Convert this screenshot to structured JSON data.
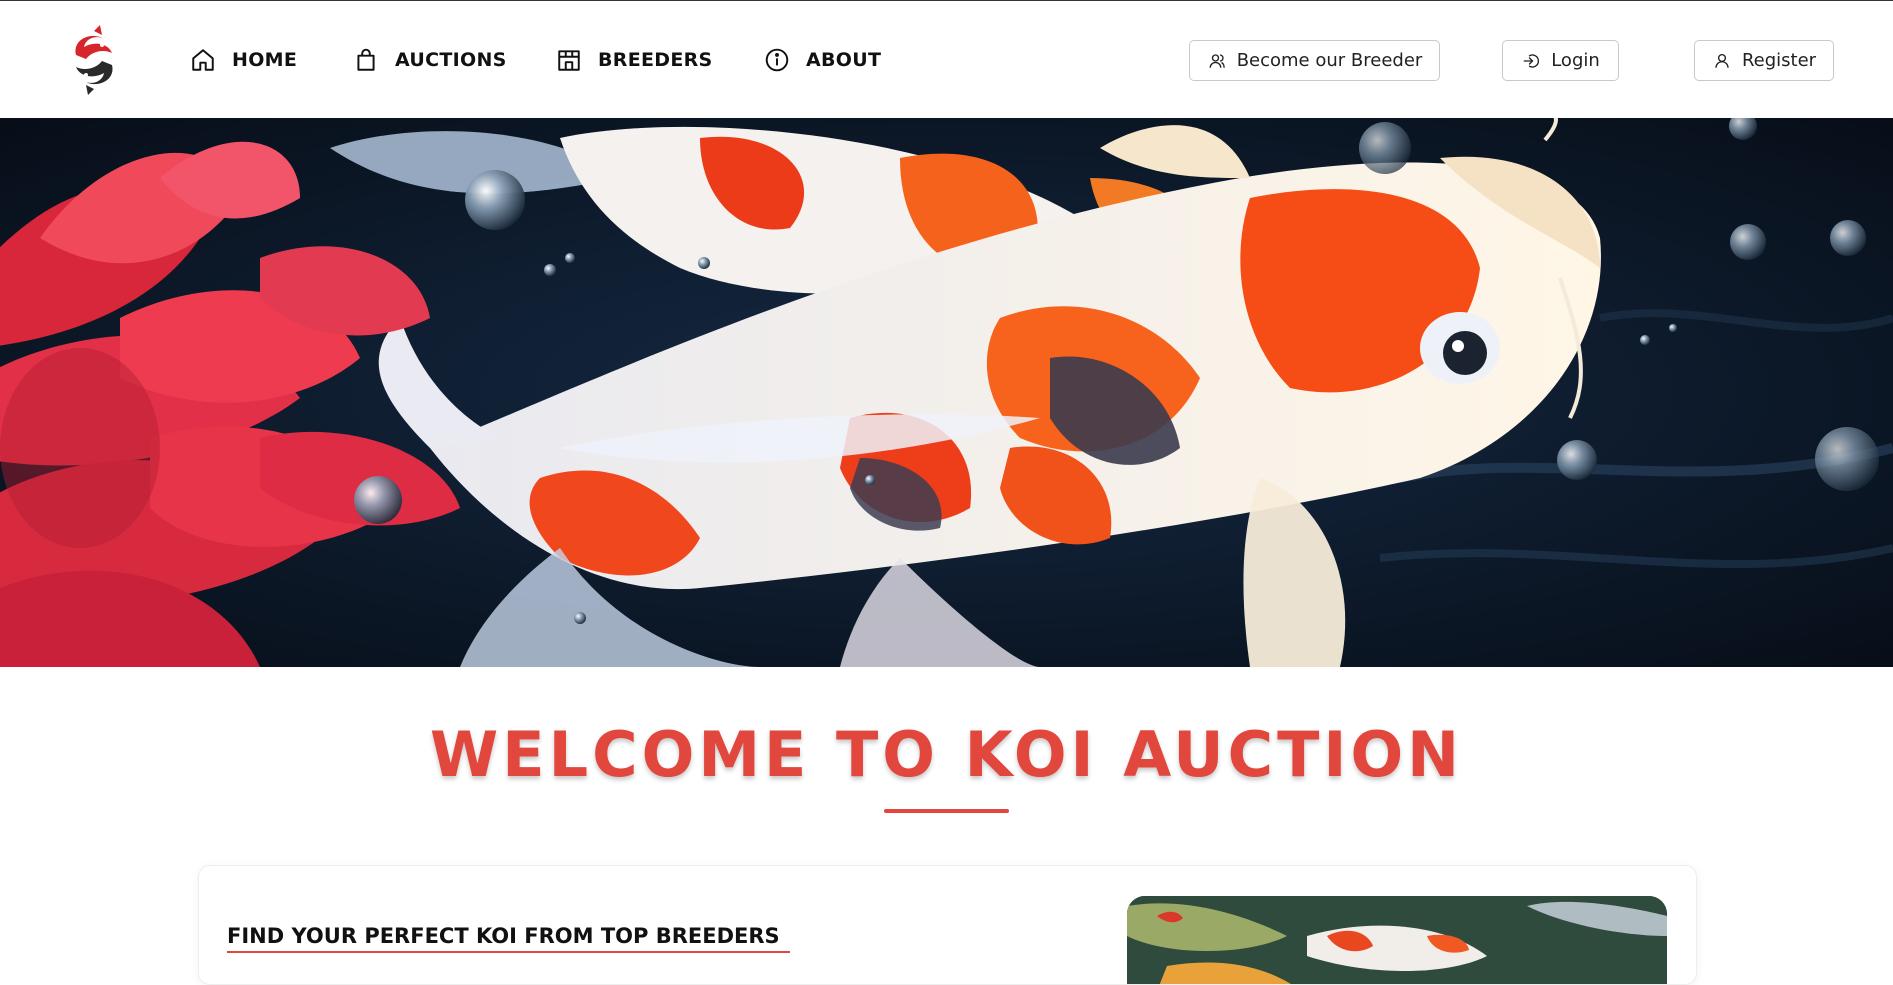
{
  "nav": {
    "items": [
      {
        "label": "HOME",
        "icon": "home-icon"
      },
      {
        "label": "AUCTIONS",
        "icon": "shopping-bag-icon"
      },
      {
        "label": "BREEDERS",
        "icon": "store-icon"
      },
      {
        "label": "ABOUT",
        "icon": "info-icon"
      }
    ]
  },
  "actions": {
    "become_breeder": "Become our Breeder",
    "login": "Login",
    "register": "Register"
  },
  "hero": {
    "description": "Koi fish swimming beside a red flower"
  },
  "welcome": {
    "title": "WELCOME TO KOI AUCTION"
  },
  "feature": {
    "title": "FIND YOUR PERFECT KOI FROM TOP BREEDERS"
  },
  "colors": {
    "accent": "#e2473d",
    "text": "#111111",
    "border": "#c9c9c9"
  }
}
